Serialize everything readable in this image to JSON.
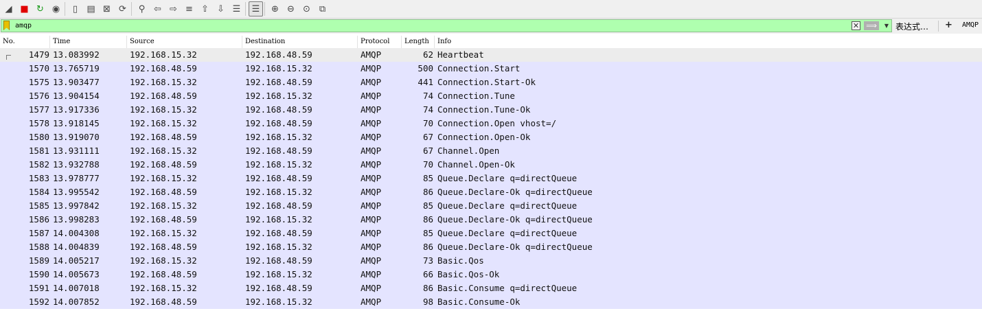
{
  "toolbar": {
    "buttons": [
      {
        "name": "start-capture-icon",
        "glyph": "◢"
      },
      {
        "name": "stop-capture-icon",
        "glyph": "■"
      },
      {
        "name": "restart-capture-icon",
        "glyph": "↻"
      },
      {
        "name": "capture-options-icon",
        "glyph": "◉"
      },
      {
        "name": "open-file-icon",
        "glyph": "▯"
      },
      {
        "name": "save-file-icon",
        "glyph": "▤"
      },
      {
        "name": "close-file-icon",
        "glyph": "⊠"
      },
      {
        "name": "reload-file-icon",
        "glyph": "⟳"
      },
      {
        "name": "find-packet-icon",
        "glyph": "⚲"
      },
      {
        "name": "go-back-icon",
        "glyph": "⇦"
      },
      {
        "name": "go-forward-icon",
        "glyph": "⇨"
      },
      {
        "name": "go-to-packet-icon",
        "glyph": "≡"
      },
      {
        "name": "go-to-first-icon",
        "glyph": "⇧"
      },
      {
        "name": "go-to-last-icon",
        "glyph": "⇩"
      },
      {
        "name": "auto-scroll-icon",
        "glyph": "☰"
      },
      {
        "name": "colorize-icon",
        "glyph": "☰"
      },
      {
        "name": "zoom-in-icon",
        "glyph": "⊕"
      },
      {
        "name": "zoom-out-icon",
        "glyph": "⊖"
      },
      {
        "name": "normal-size-icon",
        "glyph": "⊙"
      },
      {
        "name": "resize-columns-icon",
        "glyph": "⧉"
      }
    ]
  },
  "filter": {
    "value": "amqp",
    "clear_glyph": "✕",
    "apply_glyph": "⟹",
    "dropdown_glyph": "▼",
    "expression_label": "表达式…",
    "plus_label": "+",
    "saved_button_label": "AMQP"
  },
  "columns": [
    "No.",
    "Time",
    "Source",
    "Destination",
    "Protocol",
    "Length",
    "Info"
  ],
  "packets": [
    {
      "no": "1479",
      "time": "13.083992",
      "src": "192.168.15.32",
      "dst": "192.168.48.59",
      "proto": "AMQP",
      "len": "62",
      "info": "Heartbeat"
    },
    {
      "no": "1570",
      "time": "13.765719",
      "src": "192.168.48.59",
      "dst": "192.168.15.32",
      "proto": "AMQP",
      "len": "500",
      "info": "Connection.Start"
    },
    {
      "no": "1575",
      "time": "13.903477",
      "src": "192.168.15.32",
      "dst": "192.168.48.59",
      "proto": "AMQP",
      "len": "441",
      "info": "Connection.Start-Ok"
    },
    {
      "no": "1576",
      "time": "13.904154",
      "src": "192.168.48.59",
      "dst": "192.168.15.32",
      "proto": "AMQP",
      "len": "74",
      "info": "Connection.Tune"
    },
    {
      "no": "1577",
      "time": "13.917336",
      "src": "192.168.15.32",
      "dst": "192.168.48.59",
      "proto": "AMQP",
      "len": "74",
      "info": "Connection.Tune-Ok"
    },
    {
      "no": "1578",
      "time": "13.918145",
      "src": "192.168.15.32",
      "dst": "192.168.48.59",
      "proto": "AMQP",
      "len": "70",
      "info": "Connection.Open vhost=/"
    },
    {
      "no": "1580",
      "time": "13.919070",
      "src": "192.168.48.59",
      "dst": "192.168.15.32",
      "proto": "AMQP",
      "len": "67",
      "info": "Connection.Open-Ok"
    },
    {
      "no": "1581",
      "time": "13.931111",
      "src": "192.168.15.32",
      "dst": "192.168.48.59",
      "proto": "AMQP",
      "len": "67",
      "info": "Channel.Open"
    },
    {
      "no": "1582",
      "time": "13.932788",
      "src": "192.168.48.59",
      "dst": "192.168.15.32",
      "proto": "AMQP",
      "len": "70",
      "info": "Channel.Open-Ok"
    },
    {
      "no": "1583",
      "time": "13.978777",
      "src": "192.168.15.32",
      "dst": "192.168.48.59",
      "proto": "AMQP",
      "len": "85",
      "info": "Queue.Declare q=directQueue"
    },
    {
      "no": "1584",
      "time": "13.995542",
      "src": "192.168.48.59",
      "dst": "192.168.15.32",
      "proto": "AMQP",
      "len": "86",
      "info": "Queue.Declare-Ok q=directQueue"
    },
    {
      "no": "1585",
      "time": "13.997842",
      "src": "192.168.15.32",
      "dst": "192.168.48.59",
      "proto": "AMQP",
      "len": "85",
      "info": "Queue.Declare q=directQueue"
    },
    {
      "no": "1586",
      "time": "13.998283",
      "src": "192.168.48.59",
      "dst": "192.168.15.32",
      "proto": "AMQP",
      "len": "86",
      "info": "Queue.Declare-Ok q=directQueue"
    },
    {
      "no": "1587",
      "time": "14.004308",
      "src": "192.168.15.32",
      "dst": "192.168.48.59",
      "proto": "AMQP",
      "len": "85",
      "info": "Queue.Declare q=directQueue"
    },
    {
      "no": "1588",
      "time": "14.004839",
      "src": "192.168.48.59",
      "dst": "192.168.15.32",
      "proto": "AMQP",
      "len": "86",
      "info": "Queue.Declare-Ok q=directQueue"
    },
    {
      "no": "1589",
      "time": "14.005217",
      "src": "192.168.15.32",
      "dst": "192.168.48.59",
      "proto": "AMQP",
      "len": "73",
      "info": "Basic.Qos"
    },
    {
      "no": "1590",
      "time": "14.005673",
      "src": "192.168.48.59",
      "dst": "192.168.15.32",
      "proto": "AMQP",
      "len": "66",
      "info": "Basic.Qos-Ok"
    },
    {
      "no": "1591",
      "time": "14.007018",
      "src": "192.168.15.32",
      "dst": "192.168.48.59",
      "proto": "AMQP",
      "len": "86",
      "info": "Basic.Consume q=directQueue"
    },
    {
      "no": "1592",
      "time": "14.007852",
      "src": "192.168.48.59",
      "dst": "192.168.15.32",
      "proto": "AMQP",
      "len": "98",
      "info": "Basic.Consume-Ok"
    }
  ],
  "colors": {
    "filter_valid": "#afffaf",
    "row_amqp": "#e4e4ff",
    "row_selected": "#ececec",
    "stop_red": "#e00000",
    "restart_green": "#1a9a1a"
  }
}
